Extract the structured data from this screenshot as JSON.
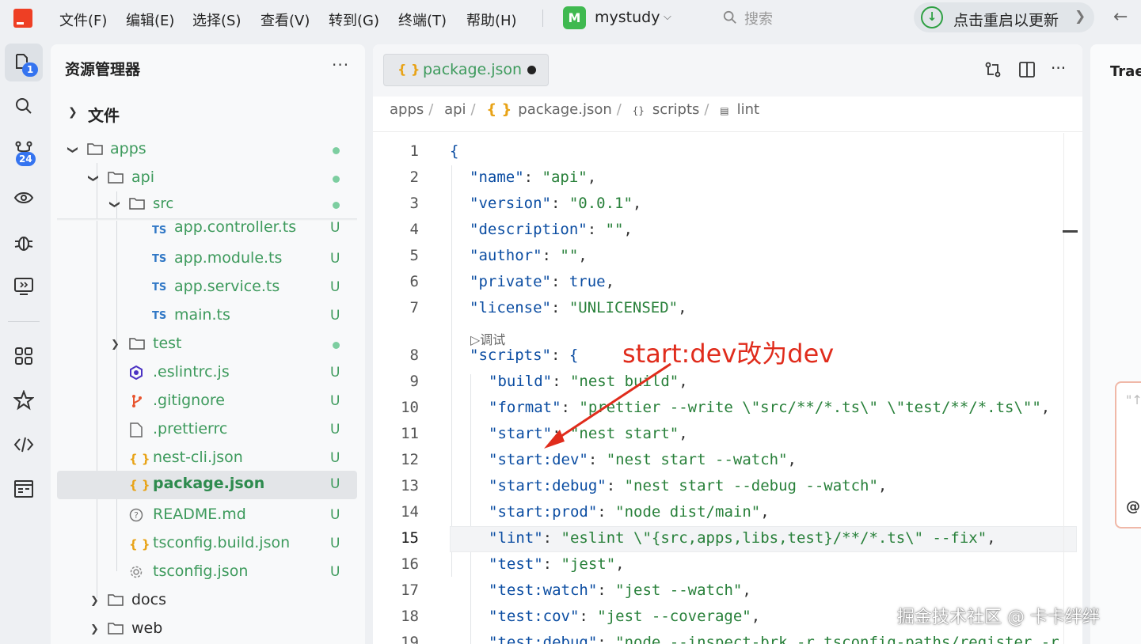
{
  "menu": [
    "文件(F)",
    "编辑(E)",
    "选择(S)",
    "查看(V)",
    "转到(G)",
    "终端(T)",
    "帮助(H)"
  ],
  "project": {
    "badge": "M",
    "name": "mystudy"
  },
  "search": {
    "placeholder": "搜索"
  },
  "update": {
    "label": "点击重启以更新"
  },
  "activity": {
    "explorer_badge": "1",
    "scm_badge": "24"
  },
  "explorer": {
    "title": "资源管理器",
    "section": "文件",
    "items": [
      {
        "label": "apps"
      },
      {
        "label": "api"
      },
      {
        "label": "src"
      },
      {
        "label": "app.controller.ts",
        "status": "U",
        "icon": "TS"
      },
      {
        "label": "app.module.ts",
        "status": "U",
        "icon": "TS"
      },
      {
        "label": "app.service.ts",
        "status": "U",
        "icon": "TS"
      },
      {
        "label": "main.ts",
        "status": "U",
        "icon": "TS"
      },
      {
        "label": "test"
      },
      {
        "label": ".eslintrc.js",
        "status": "U"
      },
      {
        "label": ".gitignore",
        "status": "U"
      },
      {
        "label": ".prettierrc",
        "status": "U"
      },
      {
        "label": "nest-cli.json",
        "status": "U",
        "icon": "{ }"
      },
      {
        "label": "package.json",
        "status": "U",
        "icon": "{ }"
      },
      {
        "label": "README.md",
        "status": "U"
      },
      {
        "label": "tsconfig.build.json",
        "status": "U",
        "icon": "{ }"
      },
      {
        "label": "tsconfig.json",
        "status": "U"
      },
      {
        "label": "docs"
      },
      {
        "label": "web"
      }
    ]
  },
  "editor": {
    "tab": {
      "label": "package.json",
      "icon": "{ }"
    },
    "breadcrumb": [
      "apps",
      "api",
      "package.json",
      "scripts",
      "lint"
    ],
    "breadcrumb_icon": "{ }",
    "breadcrumb_icon_small": "{}",
    "codelens": "▷调试",
    "annotation": "start:dev改为dev",
    "current_line": 15,
    "lines": [
      {
        "n": "1",
        "indent": 0,
        "parts": [
          [
            "b",
            "{"
          ]
        ]
      },
      {
        "n": "2",
        "indent": 1,
        "parts": [
          [
            "k",
            "\"name\""
          ],
          [
            "p",
            ": "
          ],
          [
            "s",
            "\"api\""
          ],
          [
            "p",
            ","
          ]
        ]
      },
      {
        "n": "3",
        "indent": 1,
        "parts": [
          [
            "k",
            "\"version\""
          ],
          [
            "p",
            ": "
          ],
          [
            "s",
            "\"0.0.1\""
          ],
          [
            "p",
            ","
          ]
        ]
      },
      {
        "n": "4",
        "indent": 1,
        "parts": [
          [
            "k",
            "\"description\""
          ],
          [
            "p",
            ": "
          ],
          [
            "s",
            "\"\""
          ],
          [
            "p",
            ","
          ]
        ]
      },
      {
        "n": "5",
        "indent": 1,
        "parts": [
          [
            "k",
            "\"author\""
          ],
          [
            "p",
            ": "
          ],
          [
            "s",
            "\"\""
          ],
          [
            "p",
            ","
          ]
        ]
      },
      {
        "n": "6",
        "indent": 1,
        "parts": [
          [
            "k",
            "\"private\""
          ],
          [
            "p",
            ": "
          ],
          [
            "b",
            "true"
          ],
          [
            "p",
            ","
          ]
        ]
      },
      {
        "n": "7",
        "indent": 1,
        "parts": [
          [
            "k",
            "\"license\""
          ],
          [
            "p",
            ": "
          ],
          [
            "s",
            "\"UNLICENSED\""
          ],
          [
            "p",
            ","
          ]
        ]
      },
      {
        "n": "8",
        "indent": 1,
        "parts": [
          [
            "k",
            "\"scripts\""
          ],
          [
            "p",
            ": "
          ],
          [
            "b",
            "{"
          ]
        ]
      },
      {
        "n": "9",
        "indent": 2,
        "parts": [
          [
            "k",
            "\"build\""
          ],
          [
            "p",
            ": "
          ],
          [
            "s",
            "\"nest build\""
          ],
          [
            "p",
            ","
          ]
        ]
      },
      {
        "n": "10",
        "indent": 2,
        "parts": [
          [
            "k",
            "\"format\""
          ],
          [
            "p",
            ": "
          ],
          [
            "s",
            "\"prettier --write \\\"src/**/*.ts\\\" \\\"test/**/*.ts\\\"\""
          ],
          [
            "p",
            ","
          ]
        ]
      },
      {
        "n": "11",
        "indent": 2,
        "parts": [
          [
            "k",
            "\"start\""
          ],
          [
            "p",
            ": "
          ],
          [
            "s",
            "\"nest start\""
          ],
          [
            "p",
            ","
          ]
        ]
      },
      {
        "n": "12",
        "indent": 2,
        "parts": [
          [
            "k",
            "\"start:dev\""
          ],
          [
            "p",
            ": "
          ],
          [
            "s",
            "\"nest start --watch\""
          ],
          [
            "p",
            ","
          ]
        ]
      },
      {
        "n": "13",
        "indent": 2,
        "parts": [
          [
            "k",
            "\"start:debug\""
          ],
          [
            "p",
            ": "
          ],
          [
            "s",
            "\"nest start --debug --watch\""
          ],
          [
            "p",
            ","
          ]
        ]
      },
      {
        "n": "14",
        "indent": 2,
        "parts": [
          [
            "k",
            "\"start:prod\""
          ],
          [
            "p",
            ": "
          ],
          [
            "s",
            "\"node dist/main\""
          ],
          [
            "p",
            ","
          ]
        ]
      },
      {
        "n": "15",
        "indent": 2,
        "parts": [
          [
            "k",
            "\"lint\""
          ],
          [
            "p",
            ": "
          ],
          [
            "s",
            "\"eslint \\\"{src,apps,libs,test}/**/*.ts\\\" --fix\""
          ],
          [
            "p",
            ","
          ]
        ]
      },
      {
        "n": "16",
        "indent": 2,
        "parts": [
          [
            "k",
            "\"test\""
          ],
          [
            "p",
            ": "
          ],
          [
            "s",
            "\"jest\""
          ],
          [
            "p",
            ","
          ]
        ]
      },
      {
        "n": "17",
        "indent": 2,
        "parts": [
          [
            "k",
            "\"test:watch\""
          ],
          [
            "p",
            ": "
          ],
          [
            "s",
            "\"jest --watch\""
          ],
          [
            "p",
            ","
          ]
        ]
      },
      {
        "n": "18",
        "indent": 2,
        "parts": [
          [
            "k",
            "\"test:cov\""
          ],
          [
            "p",
            ": "
          ],
          [
            "s",
            "\"jest --coverage\""
          ],
          [
            "p",
            ","
          ]
        ]
      },
      {
        "n": "19",
        "indent": 2,
        "parts": [
          [
            "k",
            "\"test:debug\""
          ],
          [
            "p",
            ": "
          ],
          [
            "s",
            "\"node --inspect-brk -r tsconfig-paths/register -r"
          ]
        ]
      }
    ]
  },
  "rightpanel": {
    "title": "Trae",
    "input_hint": "\"↑",
    "at": "@"
  },
  "watermark": "掘金技术社区 @ 卡卡绊绊",
  "colors": {
    "accent_green": "#3d9a5c",
    "annotation_red": "#e02c1c",
    "brand_red": "#ee3f24",
    "badge_blue": "#3574f0"
  }
}
